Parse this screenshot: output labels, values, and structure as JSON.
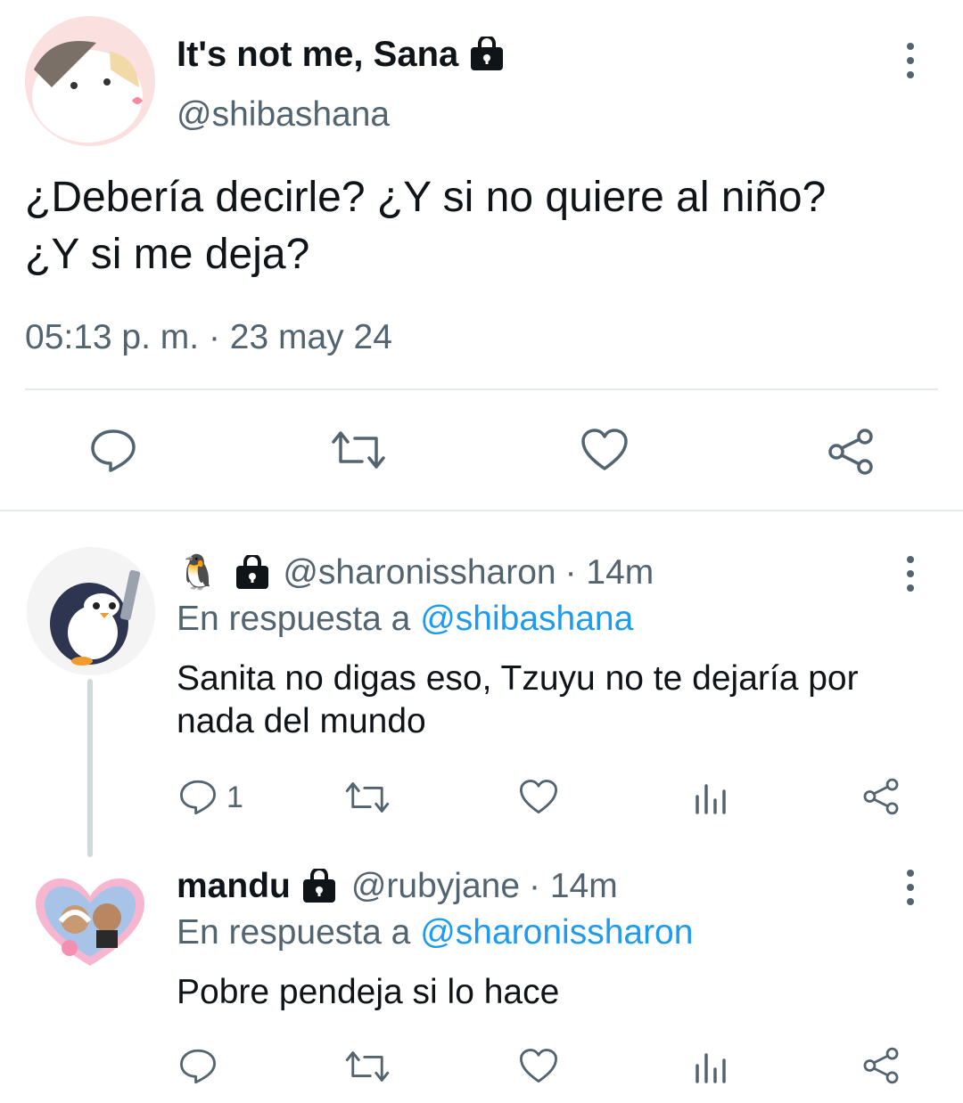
{
  "main_tweet": {
    "display_name": "It's not me, Sana",
    "handle": "@shibashana",
    "text_line1": "¿Debería decirle? ¿Y si no quiere al niño?",
    "text_line2": "¿Y si me deja?",
    "timestamp": "05:13 p. m. · 23 may 24"
  },
  "replies": [
    {
      "name_emoji": "🐧",
      "handle": "@sharonissharon",
      "time": "· 14m",
      "replying_prefix": "En respuesta a",
      "replying_to": "@shibashana",
      "text": "Sanita no digas eso, Tzuyu no te dejaría por nada del mundo",
      "reply_count": "1"
    },
    {
      "display_name": "mandu",
      "handle": "@rubyjane",
      "time": "· 14m",
      "replying_prefix": "En respuesta a",
      "replying_to": "@sharonissharon",
      "text": "Pobre pendeja si lo hace",
      "reply_count": ""
    }
  ],
  "colors": {
    "text": "#0f1419",
    "secondary": "#536471",
    "link": "#1d9bf0",
    "divider": "#e6e9ec"
  }
}
